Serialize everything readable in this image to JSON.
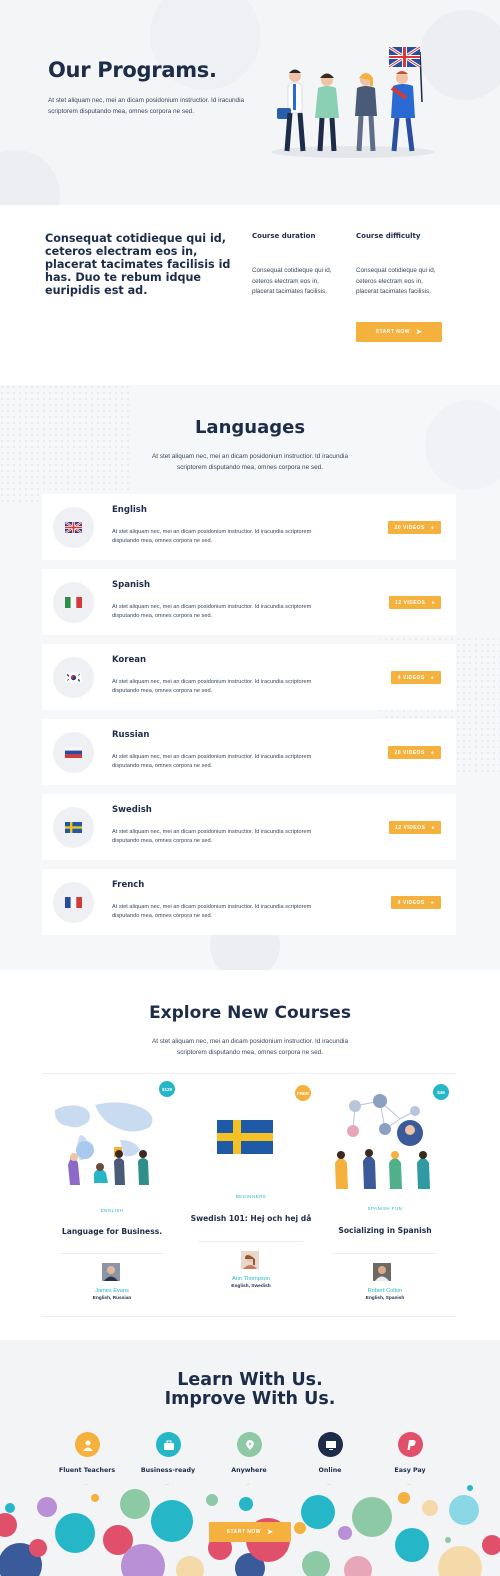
{
  "hero": {
    "title": "Our Programs.",
    "text": "At stet aliquam nec, mei an dicam posidonium instructior. Id iracundia scriptorem disputando mea, omnes corpora ne sed."
  },
  "info": {
    "heading": "Consequat cotidieque qui id, ceteros electram eos in, placerat tacimates facilisis id has. Duo te rebum idque euripidis est ad.",
    "duration_title": "Course duration",
    "duration_text": "Consequat cotidieque qui id, ceteros electram eos in, placerat tacimates facilisis.",
    "difficulty_title": "Course difficulty",
    "difficulty_text": "Consequat cotidieque qui id, ceteros electram eos in, placerat tacimates facilisis.",
    "start_label": "START NOW"
  },
  "languages": {
    "title": "Languages",
    "subtitle": "At stet aliquam nec, mei an dicam posidonium instructior. Id iracundia scriptorem disputando mea, omnes corpora ne sed.",
    "items": [
      {
        "name": "English",
        "desc": "At stet aliquam nec, mei an dicam posidonium instructior. Id iracundia scriptorem disputando mea, omnes corpora ne sed.",
        "videos": "20 VIDEOS",
        "flag": "uk-flag"
      },
      {
        "name": "Spanish",
        "desc": "At stet aliquam nec, mei an dicam posidonium instructior. Id iracundia scriptorem disputando mea, omnes corpora ne sed.",
        "videos": "12 VIDEOS",
        "flag": "italy-flag"
      },
      {
        "name": "Korean",
        "desc": "At stet aliquam nec, mei an dicam posidonium instructior. Id iracundia scriptorem disputando mea, omnes corpora ne sed.",
        "videos": "4 VIDEOS",
        "flag": "korea-flag"
      },
      {
        "name": "Russian",
        "desc": "At stet aliquam nec, mei an dicam posidonium instructior. Id iracundia scriptorem disputando mea, omnes corpora ne sed.",
        "videos": "20 VIDEOS",
        "flag": "russia-flag"
      },
      {
        "name": "Swedish",
        "desc": "At stet aliquam nec, mei an dicam posidonium instructior. Id iracundia scriptorem disputando mea, omnes corpora ne sed.",
        "videos": "12 VIDEOS",
        "flag": "sweden-flag"
      },
      {
        "name": "French",
        "desc": "At stet aliquam nec, mei an dicam posidonium instructior. Id iracundia scriptorem disputando mea, omnes corpora ne sed.",
        "videos": "4 VIDEOS",
        "flag": "france-flag"
      }
    ]
  },
  "explore": {
    "title": "Explore New Courses",
    "subtitle": "At stet aliquam nec, mei an dicam posidonium instructior. Id iracundia scriptorem disputando mea, omnes corpora ne sed.",
    "courses": [
      {
        "price": "$129",
        "category": "ENGLISH",
        "title": "Language for Business.",
        "teacher": "James Evans",
        "langs": "English, Russian"
      },
      {
        "price": "FREE",
        "category": "BEGINNERS",
        "title": "Swedish 101: Hej och hej då",
        "teacher": "Ann Thompson",
        "langs": "English, Swedish"
      },
      {
        "price": "$49",
        "category": "SPANISH FUN",
        "title": "Socializing in Spanish",
        "teacher": "Robert Colton",
        "langs": "English, Spanish"
      }
    ]
  },
  "learn": {
    "title_line1": "Learn With Us.",
    "title_line2": "Improve With Us.",
    "features": [
      {
        "label": "Fluent Teachers",
        "icon": "teacher-icon",
        "color": "#f5b13e"
      },
      {
        "label": "Business-ready",
        "icon": "briefcase-icon",
        "color": "#25b7c8"
      },
      {
        "label": "Anywhere",
        "icon": "location-pin-icon",
        "color": "#8cc9a4"
      },
      {
        "label": "Online",
        "icon": "monitor-icon",
        "color": "#1d2c49"
      },
      {
        "label": "Easy Pay",
        "icon": "paypal-icon",
        "color": "#e0506b"
      }
    ],
    "arrow": "→",
    "start_label": "START NOW"
  },
  "colors": {
    "accent": "#f5b13e",
    "teal": "#25b7c8",
    "navy": "#1d2c49"
  }
}
